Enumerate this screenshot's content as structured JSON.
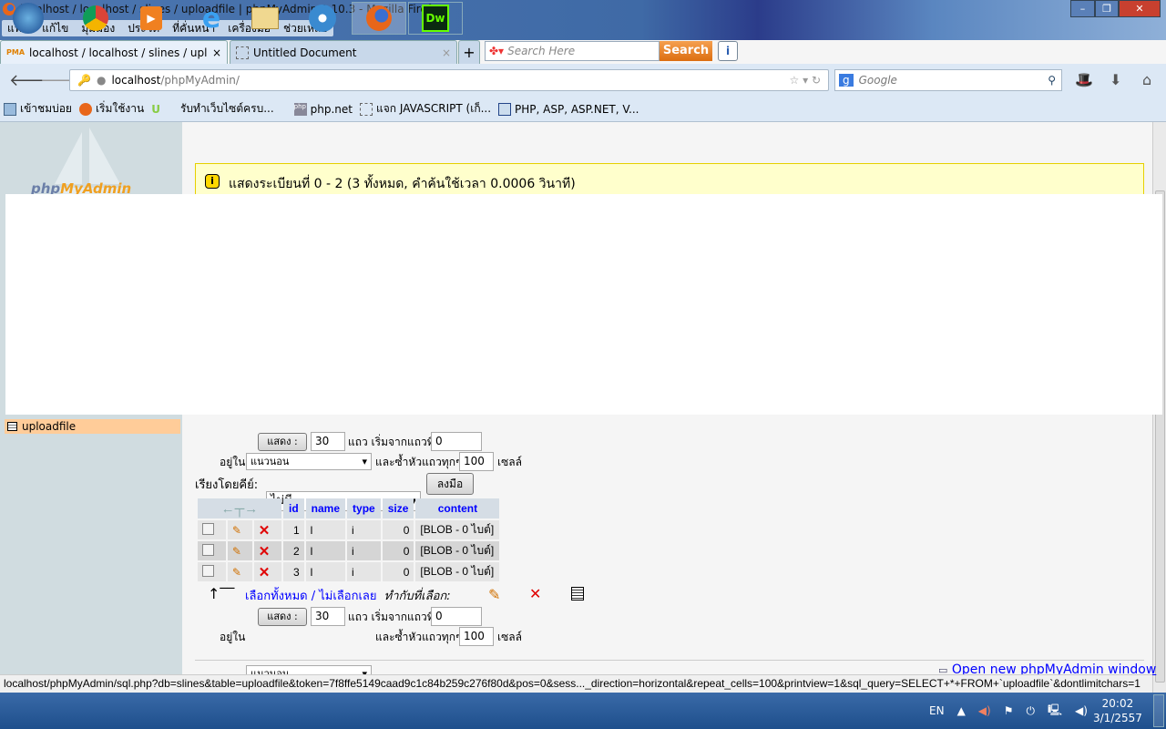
{
  "window": {
    "title": "localhost / localhost / slines / uploadfile | phpMyAdmin 2.10.3 - Mozilla Firefox",
    "controls": [
      "minimize",
      "maximize",
      "close"
    ]
  },
  "menu": [
    "แฟ้ม",
    "แก้ไข",
    "มุมมอง",
    "ประวัติ",
    "ที่คั่นหน้า",
    "เครื่องมือ",
    "ช่วยเหลือ"
  ],
  "tabs": [
    {
      "label": "localhost / localhost / slines / upload...",
      "active": true,
      "icon": "PMA"
    },
    {
      "label": "Untitled Document",
      "active": false
    }
  ],
  "toolbar_search": {
    "placeholder": "Search Here",
    "button": "Search"
  },
  "url": {
    "host": "localhost",
    "path": "/phpMyAdmin/"
  },
  "google_search": {
    "placeholder": "Google"
  },
  "bookmarks": [
    "เข้าชมบ่อย",
    "เริ่มใช้งาน",
    "",
    "รับทำเว็บไซต์ครบ...",
    "php.net",
    "แจก JAVASCRIPT (เก็...",
    "PHP, ASP, ASP.NET, V..."
  ],
  "sidebar": {
    "logo": "phpMyAdmin",
    "active_table": "uploadfile"
  },
  "info": {
    "message": "แสดงระเบียนที่ 0 - 2 (3 ทั้งหมด, คำค้นใช้เวลา 0.0006 วินาที)"
  },
  "nav_form": {
    "show_button": "แสดง :",
    "rows": "30",
    "rows_label": "แถว เริ่มจากแถวที่",
    "start": "0",
    "in_label": "อยู่ใน",
    "mode": "แนวนอน",
    "repeat_label": "และซ้ำหัวแถวทุกๆ",
    "repeat": "100",
    "cells_label": "เซลล์"
  },
  "sort": {
    "label": "เรียงโดยคีย์:",
    "value": "ไม่มี",
    "go": "ลงมือ"
  },
  "table": {
    "columns": [
      "id",
      "name",
      "type",
      "size",
      "content"
    ],
    "rows": [
      [
        "1",
        "l",
        "i",
        "0",
        "[BLOB - 0 ไบต์]"
      ],
      [
        "2",
        "l",
        "i",
        "0",
        "[BLOB - 0 ไบต์]"
      ],
      [
        "3",
        "l",
        "i",
        "0",
        "[BLOB - 0 ไบต์]"
      ]
    ]
  },
  "bulk": {
    "check_all": "เลือกทั้งหมด",
    "sep": " / ",
    "uncheck_all": "ไม่เลือกเลย",
    "with_selected": "ทำกับที่เลือก:"
  },
  "open_window": "Open new phpMyAdmin window",
  "status_url": "localhost/phpMyAdmin/sql.php?db=slines&table=uploadfile&token=7f8ffe5149caad9c1c84b259c276f80d&pos=0&sess..._direction=horizontal&repeat_cells=100&printview=1&sql_query=SELECT+*+FROM+`uploadfile`&dontlimitchars=1",
  "taskbar": {
    "apps": [
      "start",
      "chrome",
      "media-player",
      "internet-explorer",
      "explorer",
      "webcam",
      "firefox",
      "dreamweaver"
    ],
    "lang": "EN",
    "time": "20:02",
    "date": "3/1/2557"
  }
}
